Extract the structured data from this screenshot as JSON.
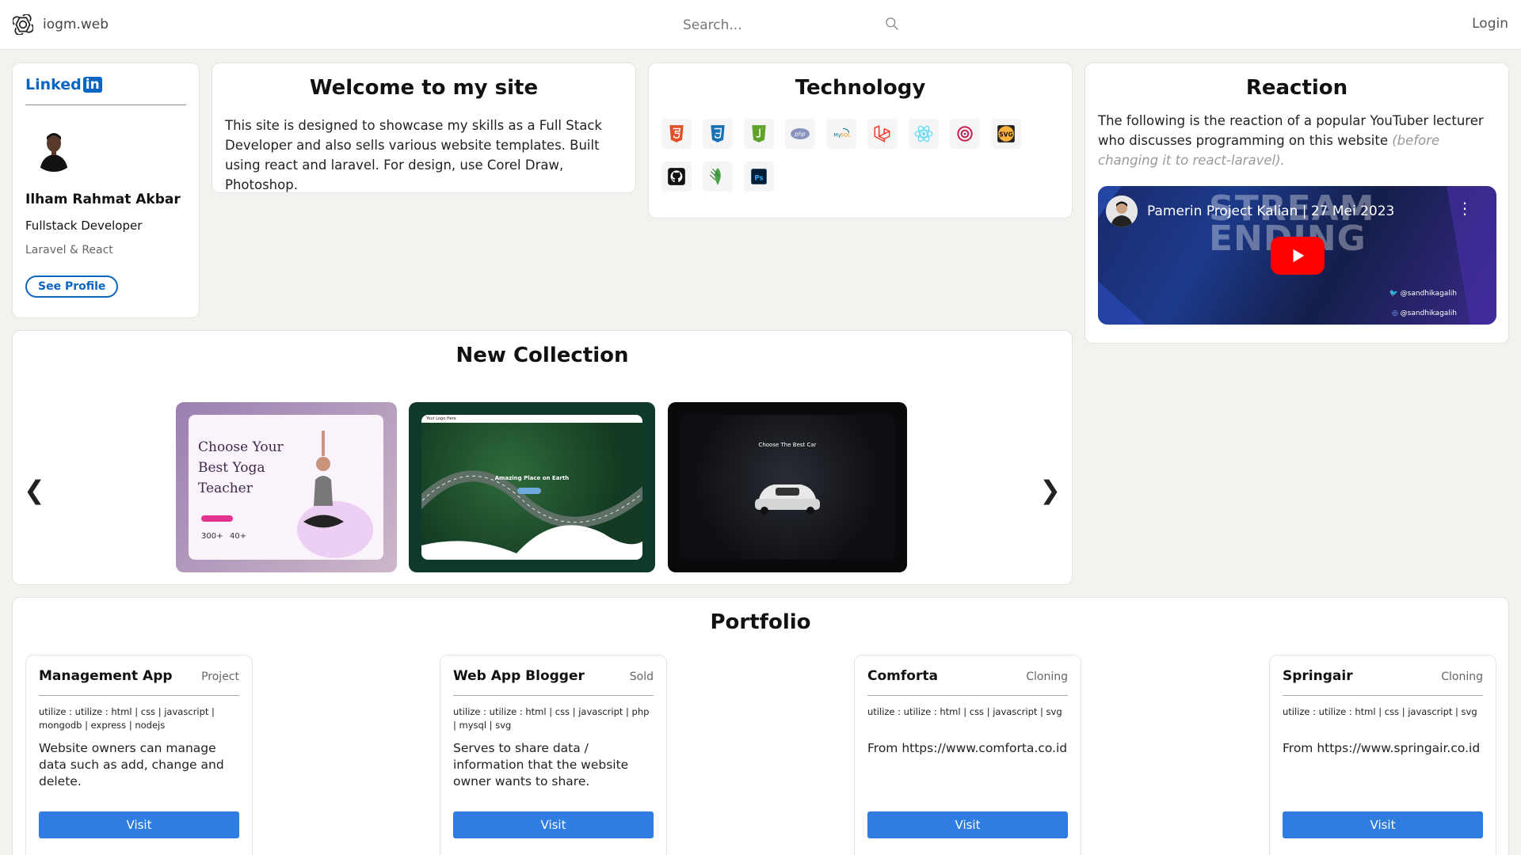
{
  "header": {
    "brand_name": "iogm.web",
    "search_placeholder": "Search...",
    "login_label": "Login"
  },
  "profile": {
    "network_word": "Linked",
    "network_badge": "in",
    "name": "Ilham Rahmat Akbar",
    "role": "Fullstack Developer",
    "skills": "Laravel & React",
    "button_label": "See Profile"
  },
  "welcome": {
    "title": "Welcome to my site",
    "body": "This site is designed to showcase my skills as a Full Stack Developer and also sells various website templates. Built using react and laravel. For design, use Corel Draw, Photoshop."
  },
  "technology": {
    "title": "Technology",
    "icons": [
      "html5-icon",
      "css3-icon",
      "javascript-icon",
      "php-icon",
      "mysql-icon",
      "laravel-icon",
      "react-icon",
      "redux-icon",
      "svg-icon",
      "github-icon",
      "mongodb-icon",
      "photoshop-icon"
    ]
  },
  "reaction": {
    "title": "Reaction",
    "body": "The following is the reaction of a popular YouTuber lecturer who discusses programming on this website",
    "note": "(before changing it to react-laravel).",
    "video": {
      "title": "Pamerin Project Kalian | 27 Mei 2023",
      "bg_text_1": "STREAM",
      "bg_text_2": "ENDING",
      "handle_1": "@sandhikagalih",
      "handle_2": "@sandhikagalih"
    }
  },
  "collection": {
    "title": "New Collection",
    "prev": "❮",
    "next": "❯",
    "slides": [
      {
        "heading": "Choose Your Best Yoga Teacher",
        "stat_1": "300+",
        "stat_2": "40+"
      },
      {
        "heading": "Amazing Place on Earth",
        "logo": "Your Logo Here"
      },
      {
        "heading": "Choose The Best Car"
      }
    ]
  },
  "portfolio": {
    "title": "Portfolio",
    "items": [
      {
        "title": "Management App",
        "tag": "Project",
        "utilize": "utilize : utilize : html | css | javascript | mongodb | express | nodejs",
        "desc": "Website owners can manage data such as add, change and delete.",
        "button": "Visit"
      },
      {
        "title": "Web App Blogger",
        "tag": "Sold",
        "utilize": "utilize : utilize : html | css | javascript | php | mysql | svg",
        "desc": "Serves to share data / information that the website owner wants to share.",
        "button": "Visit"
      },
      {
        "title": "Comforta",
        "tag": "Cloning",
        "utilize": "utilize : utilize : html | css | javascript | svg",
        "desc": "From https://www.comforta.co.id",
        "button": "Visit"
      },
      {
        "title": "Springair",
        "tag": "Cloning",
        "utilize": "utilize : utilize : html | css | javascript | svg",
        "desc": "From https://www.springair.co.id",
        "button": "Visit"
      }
    ]
  },
  "colors": {
    "linkedin_blue": "#0a66c2",
    "visit_button": "#2f7de1",
    "page_background": "#f3f2ef",
    "youtube_red": "#ff0000"
  }
}
